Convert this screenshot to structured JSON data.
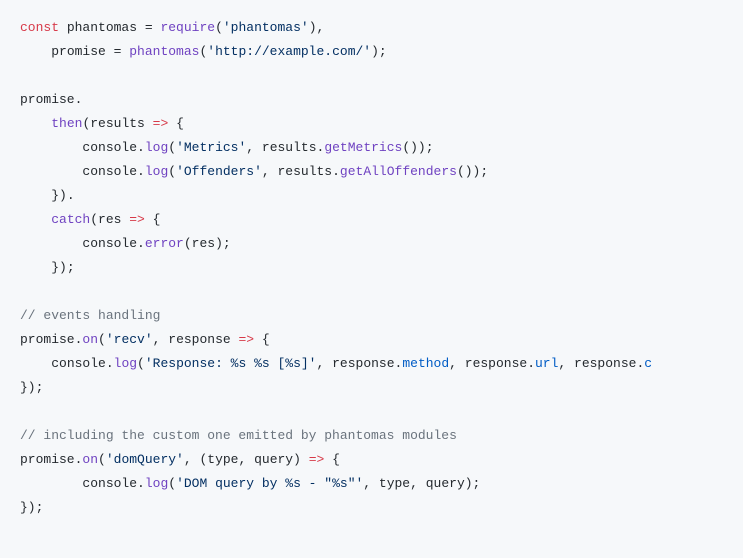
{
  "code": {
    "l1": {
      "kw": "const",
      "sp": " ",
      "id": "phantomas",
      "eq": " = ",
      "req": "require",
      "po": "(",
      "s": "'phantomas'",
      "pc": "),"
    },
    "l2": {
      "ind": "    ",
      "id": "promise",
      "eq": " = ",
      "fn": "phantomas",
      "po": "(",
      "s": "'http://example.com/'",
      "pc": ");"
    },
    "l3": "",
    "l4": {
      "id": "promise",
      "dot": "."
    },
    "l5": {
      "ind": "    ",
      "m": "then",
      "po": "(",
      "arg": "results",
      "arw": " => ",
      "cb": "{"
    },
    "l6": {
      "ind": "        ",
      "obj": "console",
      "dot": ".",
      "m": "log",
      "po": "(",
      "s": "'Metrics'",
      "comma": ", ",
      "arg": "results",
      "dot2": ".",
      "m2": "getMetrics",
      "pc": "());"
    },
    "l7": {
      "ind": "        ",
      "obj": "console",
      "dot": ".",
      "m": "log",
      "po": "(",
      "s": "'Offenders'",
      "comma": ", ",
      "arg": "results",
      "dot2": ".",
      "m2": "getAllOffenders",
      "pc": "());"
    },
    "l8": {
      "ind": "    ",
      "txt": "})."
    },
    "l9": {
      "ind": "    ",
      "m": "catch",
      "po": "(",
      "arg": "res",
      "arw": " => ",
      "cb": "{"
    },
    "l10": {
      "ind": "        ",
      "obj": "console",
      "dot": ".",
      "m": "error",
      "po": "(",
      "arg": "res",
      "pc": ");"
    },
    "l11": {
      "ind": "    ",
      "txt": "});"
    },
    "l12": "",
    "l13": {
      "c": "// events handling"
    },
    "l14": {
      "obj": "promise",
      "dot": ".",
      "m": "on",
      "po": "(",
      "s": "'recv'",
      "comma": ", ",
      "arg": "response",
      "arw": " => ",
      "cb": "{"
    },
    "l15": {
      "ind": "    ",
      "obj": "console",
      "dot": ".",
      "m": "log",
      "po": "(",
      "s": "'Response: %s %s [%s]'",
      "comma": ", ",
      "arg1": "response",
      "d1": ".",
      "p1": "method",
      "c1": ", ",
      "arg2": "response",
      "d2": ".",
      "p2": "url",
      "c2": ", ",
      "arg3": "response",
      "d3": ".",
      "p3": "c"
    },
    "l16": {
      "txt": "});"
    },
    "l17": "",
    "l18": {
      "c": "// including the custom one emitted by phantomas modules"
    },
    "l19": {
      "obj": "promise",
      "dot": ".",
      "m": "on",
      "po": "(",
      "s": "'domQuery'",
      "comma": ", (",
      "arg1": "type",
      "c1": ", ",
      "arg2": "query",
      "pc": ") ",
      "arw": "=>",
      "cb": " {"
    },
    "l20": {
      "ind": "        ",
      "obj": "console",
      "dot": ".",
      "m": "log",
      "po": "(",
      "s": "'DOM query by %s - \"%s\"'",
      "comma": ", ",
      "a1": "type",
      "c1": ", ",
      "a2": "query",
      "pc": ");"
    },
    "l21": {
      "txt": "});"
    }
  }
}
